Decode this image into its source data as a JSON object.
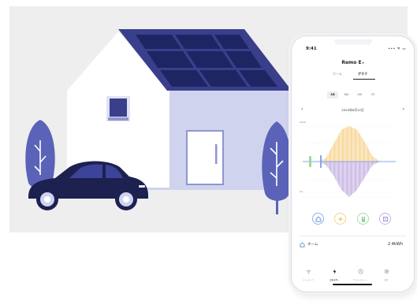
{
  "phone": {
    "time": "9:41",
    "system_icons": "••• ᯤ ▭",
    "app_title": "Remo E",
    "app_title_suffix": "▾",
    "tabs": [
      {
        "label": "ホーム"
      },
      {
        "label": "グラフ"
      }
    ],
    "ranges": [
      {
        "label": "1D"
      },
      {
        "label": "1W"
      },
      {
        "label": "1M"
      },
      {
        "label": "1Y"
      }
    ],
    "date": "2020年6月12日",
    "date_prev": "‹",
    "date_next": "›",
    "chart_axis": {
      "top_label": "Power",
      "bottom_label": "kw"
    },
    "home_row": {
      "label": "ホーム",
      "value": "2.4kWh"
    },
    "nav": [
      {
        "label": "コントローラ",
        "icon": "wifi-icon"
      },
      {
        "label": "エネルギー",
        "icon": "bolt-icon"
      },
      {
        "label": "アクティビティー",
        "icon": "clock-icon"
      },
      {
        "label": "設定",
        "icon": "gear-icon"
      }
    ]
  },
  "colors": {
    "scene_bg": "#eeeeee",
    "house_wall_front": "#ffffff",
    "house_wall_side": "#cfd3ee",
    "roof": "#3a3f8c",
    "solar_panel": "#1f2563",
    "car": "#1d2150",
    "tree": "#5a63b8",
    "solar_curve": "#f6cb7a",
    "consumption_curve": "#b8a2dd",
    "grid_green": "#9ed89a",
    "grid_blue": "#86a8e8"
  },
  "chart_data": {
    "type": "area",
    "x": [
      0,
      2,
      4,
      6,
      8,
      10,
      12,
      14,
      16,
      18,
      20,
      22,
      24
    ],
    "series": [
      {
        "values": [
          0,
          0,
          0,
          0.1,
          0.5,
          0.9,
          1.0,
          0.9,
          0.55,
          0.15,
          0,
          0,
          0
        ]
      },
      {
        "values": [
          0,
          0,
          0,
          -0.1,
          -0.4,
          -0.8,
          -1.0,
          -0.8,
          -0.45,
          -0.1,
          0,
          0,
          0
        ]
      }
    ],
    "title": "",
    "xlabel": "",
    "ylabel": ""
  }
}
